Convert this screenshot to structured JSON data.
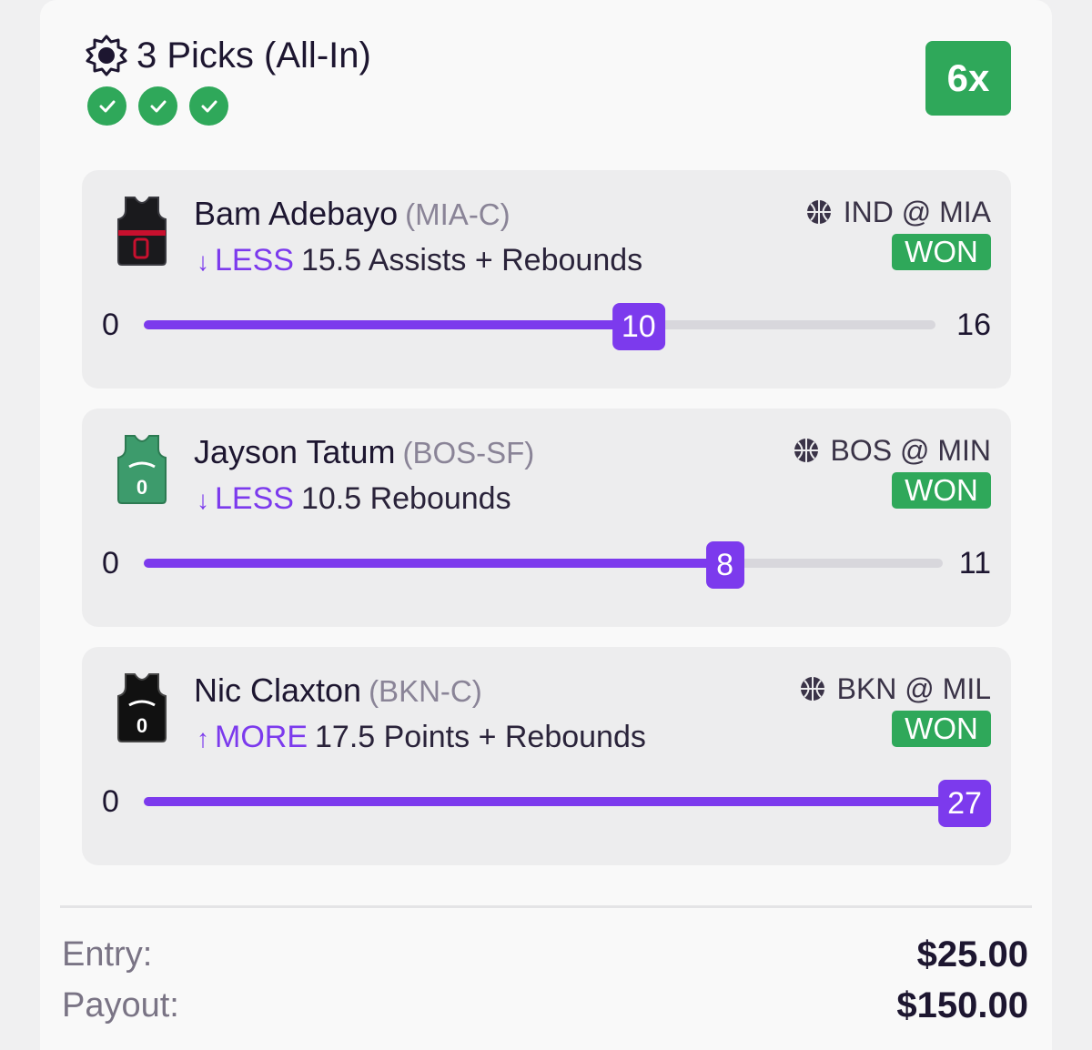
{
  "header": {
    "title": "3 Picks (All-In)",
    "multiplier": "6x",
    "icon": "gear-badge-icon",
    "checks": [
      "check-icon",
      "check-icon",
      "check-icon"
    ]
  },
  "picks": [
    {
      "name": "Bam Adebayo",
      "team": "(MIA-C)",
      "direction": "LESS",
      "arrow": "↓",
      "line": "15.5 Assists + Rebounds",
      "matchup": "IND @ MIA",
      "status": "WON",
      "range_min": "0",
      "range_max": "16",
      "actual": "10",
      "actual_value": 10,
      "max_value": 16,
      "jersey_color": "#1a1a1d",
      "jersey_accent": "#c8102e"
    },
    {
      "name": "Jayson Tatum",
      "team": "(BOS-SF)",
      "direction": "LESS",
      "arrow": "↓",
      "line": "10.5 Rebounds",
      "matchup": "BOS @ MIN",
      "status": "WON",
      "range_min": "0",
      "range_max": "11",
      "actual": "8",
      "actual_value": 8,
      "max_value": 11,
      "jersey_color": "#3d9b6c",
      "jersey_accent": "#ffffff"
    },
    {
      "name": "Nic Claxton",
      "team": "(BKN-C)",
      "direction": "MORE",
      "arrow": "↑",
      "line": "17.5 Points + Rebounds",
      "matchup": "BKN @ MIL",
      "status": "WON",
      "range_min": "0",
      "range_max": "",
      "actual": "27",
      "actual_value": 27,
      "max_value": 27,
      "jersey_color": "#111111",
      "jersey_accent": "#ffffff"
    }
  ],
  "footer": {
    "entry_label": "Entry:",
    "entry_value": "$25.00",
    "payout_label": "Payout:",
    "payout_value": "$150.00"
  },
  "colors": {
    "accent": "#7c3aed",
    "success": "#2fa85a",
    "text": "#1d1630",
    "muted": "#8a8497"
  }
}
